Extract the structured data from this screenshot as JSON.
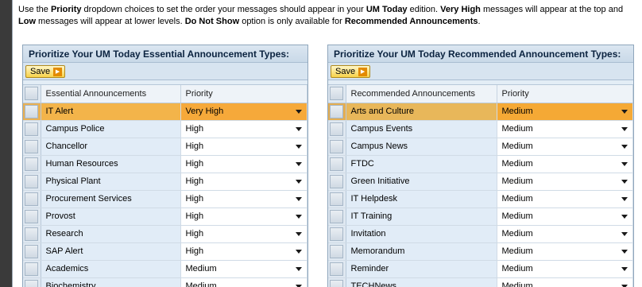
{
  "intro": {
    "p1": "Use the ",
    "b1": "Priority",
    "p2": " dropdown choices to set the order your messages should appear in your ",
    "b2": "UM Today",
    "p3": " edition. ",
    "b3": "Very High",
    "p4": " messages will appear at the top and ",
    "b4": "Low",
    "p5": " messages will appear at lower levels. ",
    "b5": "Do Not Show",
    "p6": " option is only available for ",
    "b6": "Recommended Announcements",
    "p7": "."
  },
  "essential": {
    "title": "Prioritize Your UM Today Essential Announcement Types:",
    "save_label": "Save",
    "col_name": "Essential Announcements",
    "col_priority": "Priority",
    "rows": [
      {
        "name": "IT Alert",
        "priority": "Very High"
      },
      {
        "name": "Campus Police",
        "priority": "High"
      },
      {
        "name": "Chancellor",
        "priority": "High"
      },
      {
        "name": "Human Resources",
        "priority": "High"
      },
      {
        "name": "Physical Plant",
        "priority": "High"
      },
      {
        "name": "Procurement Services",
        "priority": "High"
      },
      {
        "name": "Provost",
        "priority": "High"
      },
      {
        "name": "Research",
        "priority": "High"
      },
      {
        "name": "SAP Alert",
        "priority": "High"
      },
      {
        "name": "Academics",
        "priority": "Medium"
      },
      {
        "name": "Biochemistry",
        "priority": "Medium"
      }
    ]
  },
  "recommended": {
    "title": "Prioritize Your UM Today Recommended Announcement Types:",
    "save_label": "Save",
    "col_name": "Recommended Announcements",
    "col_priority": "Priority",
    "rows": [
      {
        "name": "Arts and Culture",
        "priority": "Medium"
      },
      {
        "name": "Campus Events",
        "priority": "Medium"
      },
      {
        "name": "Campus News",
        "priority": "Medium"
      },
      {
        "name": "FTDC",
        "priority": "Medium"
      },
      {
        "name": "Green Initiative",
        "priority": "Medium"
      },
      {
        "name": "IT Helpdesk",
        "priority": "Medium"
      },
      {
        "name": "IT Training",
        "priority": "Medium"
      },
      {
        "name": "Invitation",
        "priority": "Medium"
      },
      {
        "name": "Memorandum",
        "priority": "Medium"
      },
      {
        "name": "Reminder",
        "priority": "Medium"
      },
      {
        "name": "TECHNews",
        "priority": "Medium"
      }
    ]
  },
  "colors": {
    "highlight": "#f6a93a",
    "panel_bg": "#e3edf6",
    "page_bg": "#3a3a3a"
  },
  "icons": {
    "save_arrow": "play-arrow-icon",
    "dropdown": "chevron-down-icon"
  }
}
